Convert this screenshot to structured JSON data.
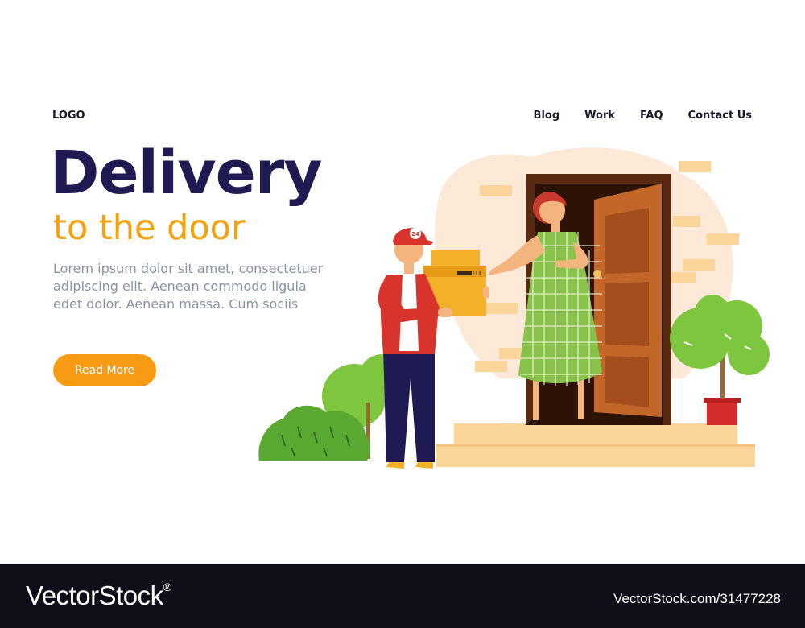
{
  "header": {
    "logo": "LOGO",
    "nav": [
      "Blog",
      "Work",
      "FAQ",
      "Contact Us"
    ]
  },
  "hero": {
    "title": "Delivery",
    "subtitle": "to the door",
    "description": "Lorem ipsum dolor sit amet, consectetuer adipiscing elit. Aenean commodo ligula edet dolor. Aenean massa. Cum sociis",
    "cta_label": "Read More"
  },
  "illustration": {
    "cap_badge": "24"
  },
  "footer": {
    "brand": "VectorStock",
    "reg_mark": "®",
    "image_id": "VectorStock.com/31477228"
  },
  "colors": {
    "title": "#1f1b52",
    "subtitle": "#f5a20a",
    "button": "#f89b14",
    "footer_bg": "#0f0f19"
  }
}
